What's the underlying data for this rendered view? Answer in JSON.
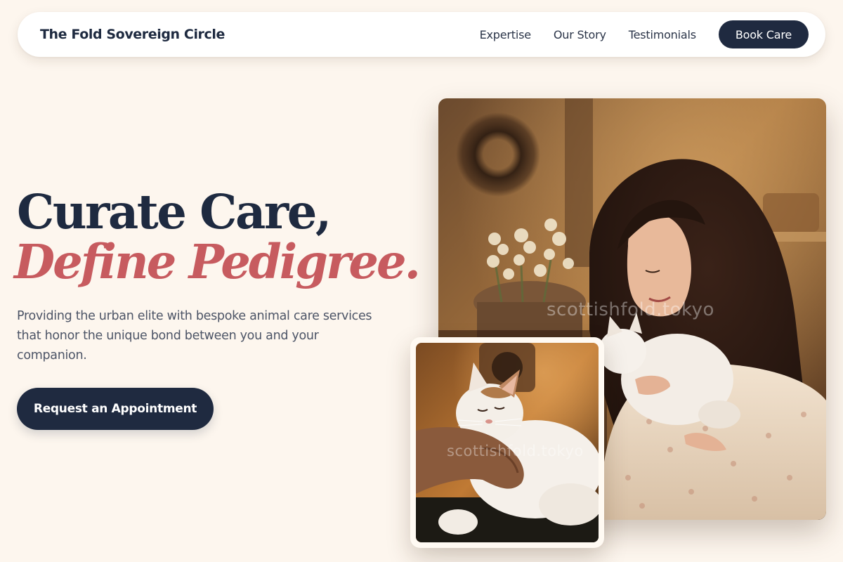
{
  "nav": {
    "brand": "The Fold Sovereign Circle",
    "links": [
      "Expertise",
      "Our Story",
      "Testimonials"
    ],
    "cta": "Book Care"
  },
  "hero": {
    "title_line_1": "Curate Care,",
    "title_line_2": "Define Pedigree.",
    "description": "Providing the urban elite with bespoke animal care services that honor the unique bond between you and your companion.",
    "cta": "Request an Appointment"
  },
  "images": {
    "main": {
      "subject": "woman-holding-white-kitten",
      "watermark": "scottishfold.tokyo"
    },
    "inset": {
      "subject": "hand-petting-calico-cat",
      "watermark": "scottishfold.tokyo"
    }
  },
  "colors": {
    "background": "#fdf6ee",
    "navy": "#1f2a40",
    "accent_rose": "#c75b5f",
    "body_text": "#4c5466"
  }
}
